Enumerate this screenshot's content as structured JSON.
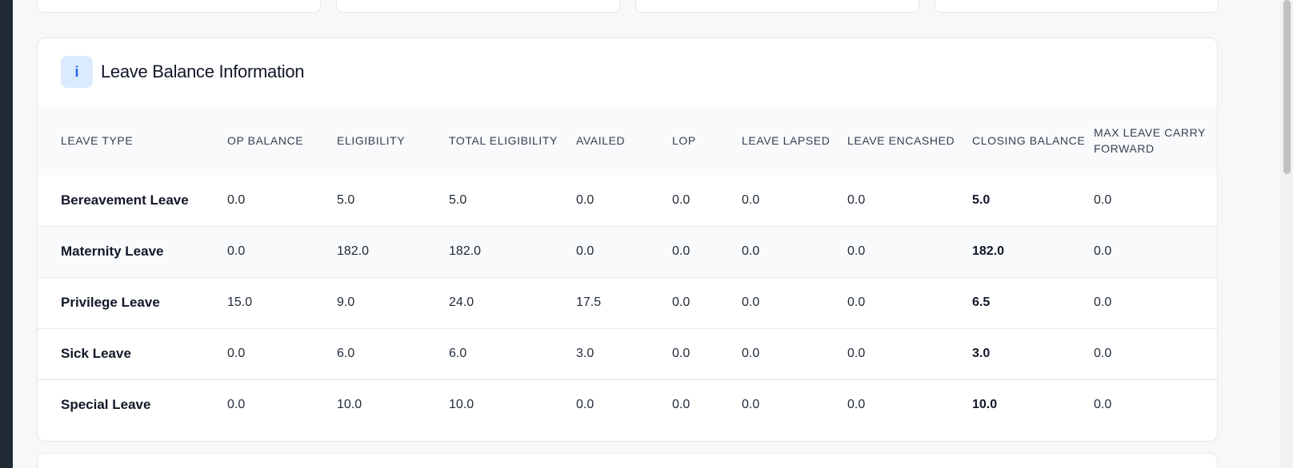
{
  "panel": {
    "icon": "info-icon",
    "icon_glyph": "i",
    "title": "Leave Balance Information"
  },
  "table": {
    "headers": [
      "LEAVE TYPE",
      "OP BALANCE",
      "ELIGIBILITY",
      "TOTAL ELIGIBILITY",
      "AVAILED",
      "LOP",
      "LEAVE LAPSED",
      "LEAVE ENCASHED",
      "CLOSING BALANCE",
      "MAX LEAVE CARRY FORWARD"
    ],
    "rows": [
      {
        "type": "Bereavement Leave",
        "op_balance": "0.0",
        "eligibility": "5.0",
        "total_eligibility": "5.0",
        "availed": "0.0",
        "lop": "0.0",
        "lapsed": "0.0",
        "encashed": "0.0",
        "closing": "5.0",
        "max_carry": "0.0"
      },
      {
        "type": "Maternity Leave",
        "op_balance": "0.0",
        "eligibility": "182.0",
        "total_eligibility": "182.0",
        "availed": "0.0",
        "lop": "0.0",
        "lapsed": "0.0",
        "encashed": "0.0",
        "closing": "182.0",
        "max_carry": "0.0"
      },
      {
        "type": "Privilege Leave",
        "op_balance": "15.0",
        "eligibility": "9.0",
        "total_eligibility": "24.0",
        "availed": "17.5",
        "lop": "0.0",
        "lapsed": "0.0",
        "encashed": "0.0",
        "closing": "6.5",
        "max_carry": "0.0"
      },
      {
        "type": "Sick Leave",
        "op_balance": "0.0",
        "eligibility": "6.0",
        "total_eligibility": "6.0",
        "availed": "3.0",
        "lop": "0.0",
        "lapsed": "0.0",
        "encashed": "0.0",
        "closing": "3.0",
        "max_carry": "0.0"
      },
      {
        "type": "Special Leave",
        "op_balance": "0.0",
        "eligibility": "10.0",
        "total_eligibility": "10.0",
        "availed": "0.0",
        "lop": "0.0",
        "lapsed": "0.0",
        "encashed": "0.0",
        "closing": "10.0",
        "max_carry": "0.0"
      }
    ]
  },
  "colors": {
    "accent": "#2563eb",
    "badge_bg": "#dbeafe",
    "sidebar": "#1f2a35"
  }
}
